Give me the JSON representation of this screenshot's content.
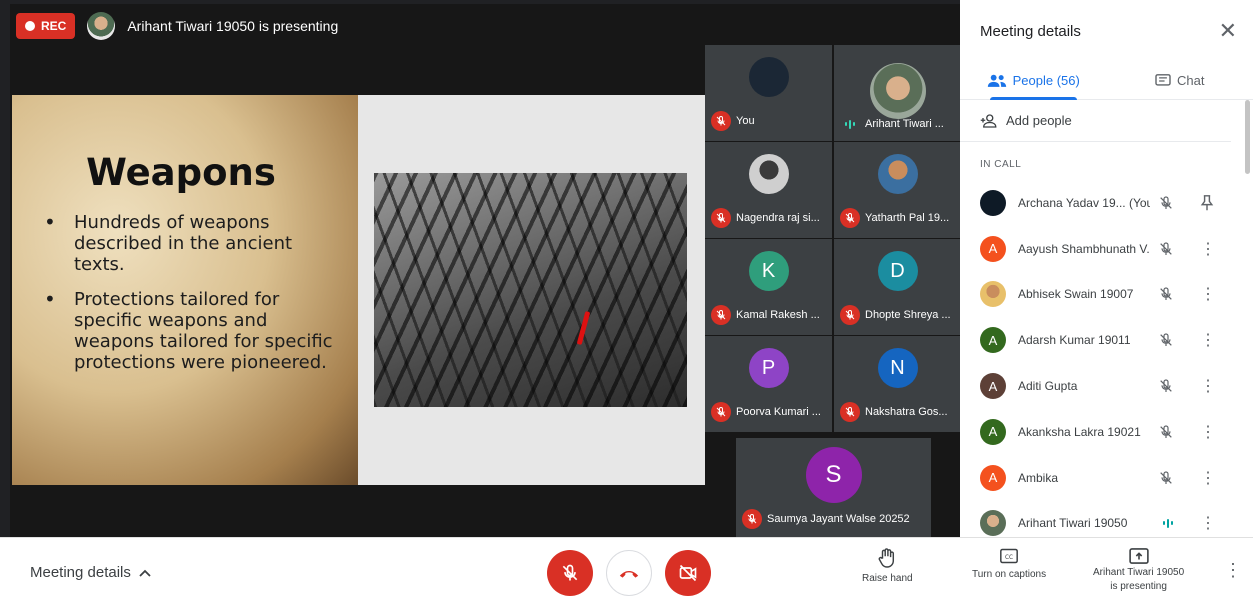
{
  "recording": {
    "label": "REC",
    "color": "#d93025"
  },
  "presenter_banner": {
    "text": "Arihant Tiwari 19050 is presenting"
  },
  "slide": {
    "title": "Weapons",
    "bullets": [
      "Hundreds of weapons described in the ancient texts.",
      "Protections tailored for specific weapons and weapons tailored for specific protections were pioneered."
    ]
  },
  "tiles": [
    {
      "name": "You",
      "initial": "",
      "avatar_color": "#1b2735",
      "status": "muted"
    },
    {
      "name": "Arihant Tiwari ...",
      "initial": "",
      "avatar_color": "#6f7a6b",
      "status": "speaking"
    },
    {
      "name": "Nagendra raj si...",
      "initial": "",
      "avatar_color": "#d5d5d5",
      "status": "muted"
    },
    {
      "name": "Yatharth Pal 19...",
      "initial": "",
      "avatar_color": "#7aa7c9",
      "status": "muted"
    },
    {
      "name": "Kamal Rakesh ...",
      "initial": "K",
      "avatar_color": "#2f9e7c",
      "status": "muted"
    },
    {
      "name": "Dhopte Shreya ...",
      "initial": "D",
      "avatar_color": "#1b8da0",
      "status": "muted"
    },
    {
      "name": "Poorva Kumari ...",
      "initial": "P",
      "avatar_color": "#8e44c6",
      "status": "muted"
    },
    {
      "name": "Nakshatra Gos...",
      "initial": "N",
      "avatar_color": "#1565c0",
      "status": "muted"
    },
    {
      "name": "Saumya Jayant Walse 20252",
      "initial": "S",
      "avatar_color": "#8e24aa",
      "status": "muted"
    }
  ],
  "panel": {
    "title": "Meeting details",
    "close_icon": "close-icon",
    "tabs": [
      {
        "label": "People (56)",
        "active": true
      },
      {
        "label": "Chat",
        "active": false
      }
    ],
    "add_people": "Add people",
    "section_label": "IN CALL",
    "accent": "#1a73e8",
    "people": [
      {
        "name": "Archana Yadav 19...  (You)",
        "initial": "",
        "color": "#0e1a26",
        "mic": "muted",
        "action": "pin"
      },
      {
        "name": "Aayush Shambhunath V...",
        "initial": "A",
        "color": "#f4511e",
        "mic": "muted",
        "action": "more"
      },
      {
        "name": "Abhisek Swain 19007",
        "initial": "",
        "color": "#c9a06a",
        "mic": "muted",
        "action": "more"
      },
      {
        "name": "Adarsh Kumar 19011",
        "initial": "A",
        "color": "#33691e",
        "mic": "muted",
        "action": "more"
      },
      {
        "name": "Aditi Gupta",
        "initial": "A",
        "color": "#5d4037",
        "mic": "muted",
        "action": "more"
      },
      {
        "name": "Akanksha Lakra 19021",
        "initial": "A",
        "color": "#33691e",
        "mic": "muted",
        "action": "more"
      },
      {
        "name": "Ambika",
        "initial": "A",
        "color": "#f4511e",
        "mic": "muted",
        "action": "more"
      },
      {
        "name": "Arihant Tiwari 19050",
        "initial": "",
        "color": "#6f7a6b",
        "mic": "speaking",
        "action": "more"
      }
    ]
  },
  "bottom": {
    "meeting_details": "Meeting details",
    "raise_hand": "Raise hand",
    "captions": "Turn on captions",
    "presenting_line1": "Arihant Tiwari 19050",
    "presenting_line2": "is presenting"
  }
}
